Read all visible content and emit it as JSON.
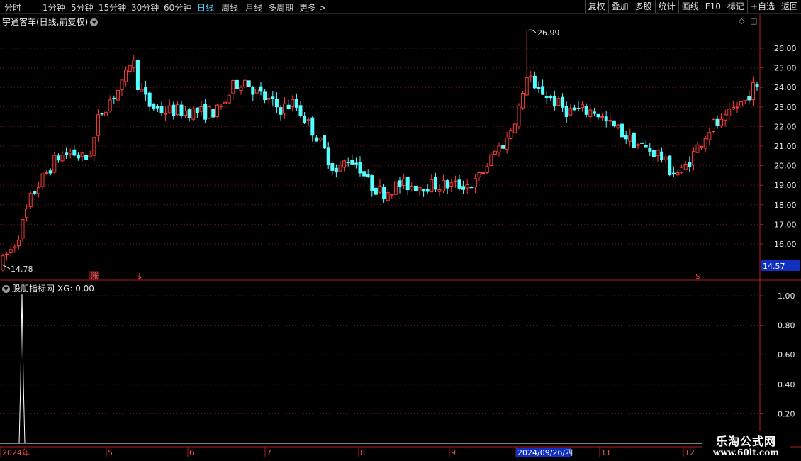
{
  "toolbar": {
    "periods": [
      "分时",
      "1分钟",
      "5分钟",
      "15分钟",
      "30分钟",
      "60分钟",
      "日线",
      "周线",
      "月线",
      "多周期",
      "更多"
    ],
    "active_period": "日线",
    "tools": [
      "复权",
      "叠加",
      "多股",
      "统计",
      "画线",
      "F10",
      "标记",
      "+自选",
      "返回"
    ]
  },
  "main_chart": {
    "title": "宇通客车(日线,前复权)",
    "max_label": "26.99",
    "min_label": "14.78",
    "current_price": "14.57",
    "price_ticks": [
      "26.00",
      "25.00",
      "24.00",
      "23.00",
      "22.00",
      "21.00",
      "20.00",
      "19.00",
      "18.00",
      "17.00",
      "16.00"
    ],
    "markers": [
      "涨",
      "$",
      "$"
    ]
  },
  "indicator": {
    "title": "股朋指标网",
    "value_label": "XG: 0.00",
    "ticks": [
      "1.00",
      "0.80",
      "0.60",
      "0.40",
      "0.20"
    ]
  },
  "time_axis": {
    "labels": [
      "2024年",
      "5",
      "6",
      "7",
      "8",
      "9",
      "2024/09/26/四",
      "11",
      "12"
    ]
  },
  "watermark": {
    "line1": "乐淘公式网",
    "line2": "www.60lt.com"
  },
  "colors": {
    "up": "#ff3c3c",
    "down": "#54ffff",
    "grid": "#7a1818",
    "axis": "#b01e1e",
    "active": "#4fd0ff"
  },
  "chart_data": {
    "type": "candlestick",
    "ylim": [
      14.57,
      26.99
    ],
    "series": [
      {
        "name": "K",
        "note": "daily candles, 2024"
      },
      {
        "name": "XG",
        "values_range": [
          0,
          1
        ]
      }
    ]
  }
}
